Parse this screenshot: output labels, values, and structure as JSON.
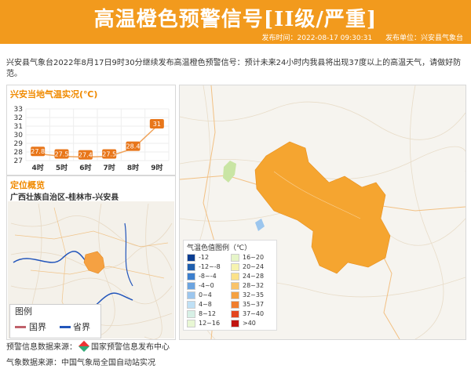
{
  "header": {
    "title": "高温橙色预警信号[II级/严重]",
    "publish_time": "发布时间：2022-08-17 09:30:31",
    "publisher": "发布单位：兴安县气象台"
  },
  "description": "兴安县气象台2022年8月17日9时30分继续发布高温橙色预警信号：预计未来24小时内我县将出现37度以上的高温天气，请做好防范。",
  "temperature_panel": {
    "title": "兴安当地气温实况(℃)"
  },
  "chart_data": {
    "type": "line",
    "categories": [
      "4时",
      "5时",
      "6时",
      "7时",
      "8时",
      "9时"
    ],
    "values": [
      27.8,
      27.5,
      27.4,
      27.5,
      28.4,
      31
    ],
    "value_labels": [
      "27.8",
      "27.5",
      "27.4",
      "27.5",
      "28.4",
      "31"
    ],
    "y_ticks": [
      "27",
      "28",
      "29",
      "30",
      "31",
      "32",
      "33"
    ],
    "ylim": [
      27,
      33
    ],
    "grid": true,
    "colors": {
      "line": "#f0a35a",
      "marker": "#e8761a"
    }
  },
  "location_panel": {
    "title": "定位概览",
    "region": "广西壮族自治区-桂林市-兴安县",
    "legend_title": "图例",
    "legend_items": [
      {
        "label": "国界",
        "color": "#c0616b"
      },
      {
        "label": "省界",
        "color": "#2255bb"
      }
    ]
  },
  "temp_legend": {
    "title": "气温色值图例（℃）",
    "items": [
      {
        "label": "-12",
        "color": "#0b3d91"
      },
      {
        "label": "16~20",
        "color": "#e6f5c8"
      },
      {
        "label": "-12~-8",
        "color": "#1f5fae"
      },
      {
        "label": "20~24",
        "color": "#f6f3b0"
      },
      {
        "label": "-8~-4",
        "color": "#3c7fce"
      },
      {
        "label": "24~28",
        "color": "#fbe28a"
      },
      {
        "label": "-4~0",
        "color": "#6ba4e0"
      },
      {
        "label": "28~32",
        "color": "#f9c36a"
      },
      {
        "label": "0~4",
        "color": "#9cc6ee"
      },
      {
        "label": "32~35",
        "color": "#f5a142"
      },
      {
        "label": "4~8",
        "color": "#bfe0f5"
      },
      {
        "label": "35~37",
        "color": "#f07e2e"
      },
      {
        "label": "8~12",
        "color": "#d7f0e6"
      },
      {
        "label": "37~40",
        "color": "#e3461e"
      },
      {
        "label": "12~16",
        "color": "#e8f7d4"
      },
      {
        "label": ">40",
        "color": "#c0140f"
      }
    ]
  },
  "footer": {
    "warning_source_label": "预警信息数据来源：",
    "warning_source": "国家预警信息发布中心",
    "weather_source": "气象数据来源：中国气象局全国自动站实况"
  }
}
